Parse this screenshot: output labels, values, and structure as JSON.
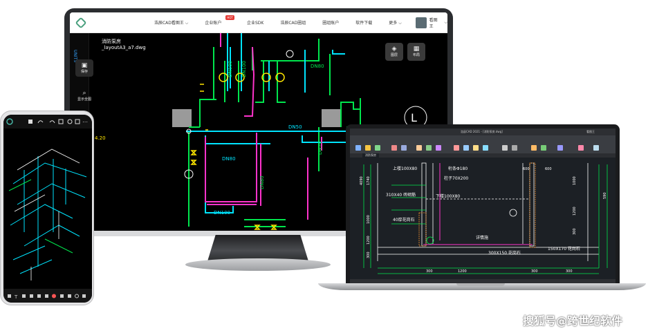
{
  "monitor": {
    "nav": {
      "items": [
        {
          "label": "浩辰CAD看图王",
          "has_dropdown": true
        },
        {
          "label": "企业账户",
          "badge": "HOT"
        },
        {
          "label": "企业SDK"
        },
        {
          "label": "浩辰CAD圈组"
        },
        {
          "label": "圈组账户"
        },
        {
          "label": "软件下载"
        },
        {
          "label": "更多",
          "has_dropdown": true
        }
      ],
      "user_name": "看图王"
    },
    "file_title_line1": "消防泵房",
    "file_title_line2": "_layoutA3_a7.dwg",
    "unit_label": "UNITS",
    "side_tools": [
      {
        "label": "保存",
        "icon": "save-icon"
      },
      {
        "label": "显示全图",
        "icon": "zoom-icon"
      }
    ],
    "right_tools": [
      {
        "label": "图层",
        "icon": "layers-icon"
      },
      {
        "label": "布局",
        "icon": "grid-icon"
      }
    ],
    "drawing_labels": {
      "dn100_a": "DN100",
      "dn100_b": "DN100",
      "dn80_top": "DN80",
      "dn50": "DN50",
      "dn70": "DN70",
      "dn80_mid": "DN80",
      "dn80_vert": "DN80",
      "dn100_low": "DN100",
      "elev": "4.20",
      "l_mark": "L"
    }
  },
  "laptop": {
    "window_title": "浩辰CAD 2021 - [消防泵房.dwg]",
    "user_label": "看图王",
    "tab_label": "消防泵房",
    "drawing_labels": {
      "top_label": "上楼100X80",
      "beam": "桁条Φ180",
      "column": "柱子70X200",
      "stairs": "310X40 砖砌筋",
      "lower": "下楼100X80",
      "thick": "40厚花岗石",
      "detail": "详情施",
      "stone1": "300X150 花岗石",
      "stone2": "150X170 花岗石",
      "dim_600a": "600",
      "dim_600b": "600",
      "dim_300a": "300",
      "dim_1200": "1200",
      "dim_300b": "300",
      "dim_300c": "300",
      "dim_1000": "1000",
      "dim_1200b": "1200",
      "dim_300d": "300",
      "dim_1740": "1740",
      "dim_4090": "4090",
      "dim_1000b": "1000",
      "dim_1200c": "1200",
      "dim_300e": "300",
      "dim_590": "590"
    }
  },
  "phone": {
    "toolbar_icons": [
      "save-icon",
      "undo-icon",
      "redo-icon",
      "select-icon",
      "zoom-icon",
      "fit-icon",
      "more-icon"
    ],
    "bottom_icons": [
      "pencil-icon",
      "text-icon",
      "layer-icon",
      "cube-icon",
      "measure-icon",
      "comment-icon",
      "color-icon",
      "image-icon",
      "grid-icon",
      "zoom-icon",
      "share-icon"
    ]
  },
  "watermark": "搜狐号@跨世纪软件",
  "colors": {
    "cad_green": "#00e64d",
    "cad_cyan": "#00e5ff",
    "cad_magenta": "#ff33cc",
    "cad_yellow": "#ffe600",
    "cad_white": "#ffffff",
    "laptop_canvas": "#1c2025"
  }
}
